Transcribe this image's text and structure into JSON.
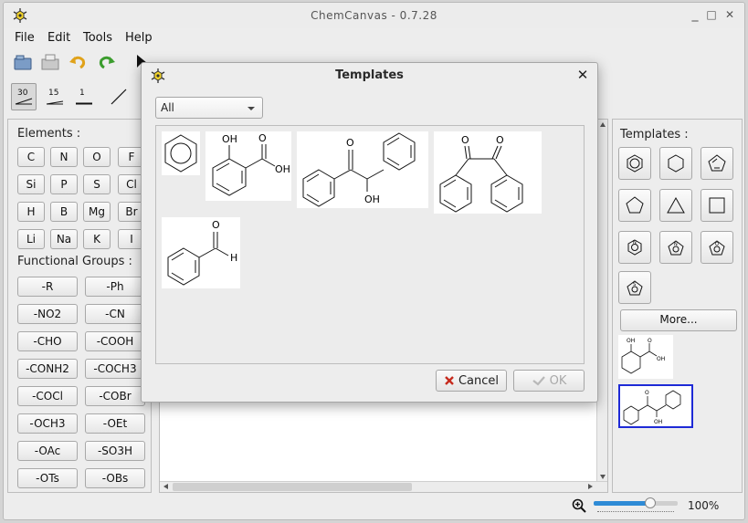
{
  "window": {
    "title": "ChemCanvas - 0.7.28",
    "controls": [
      "_",
      "□",
      "✕"
    ]
  },
  "menu": [
    "File",
    "Edit",
    "Tools",
    "Help"
  ],
  "toolbar2": {
    "bond_30": "30",
    "bond_15": "15",
    "bond_1": "1"
  },
  "left_panel": {
    "elements_label": "Elements :",
    "elements": [
      [
        "C",
        "N",
        "O",
        "F"
      ],
      [
        "Si",
        "P",
        "S",
        "Cl"
      ],
      [
        "H",
        "B",
        "Mg",
        "Br"
      ],
      [
        "Li",
        "Na",
        "K",
        "I"
      ]
    ],
    "functional_groups_label": "Functional Groups :",
    "groups": [
      [
        "-R",
        "-Ph"
      ],
      [
        "-NO2",
        "-CN"
      ],
      [
        "-CHO",
        "-COOH"
      ],
      [
        "-CONH2",
        "-COCH3"
      ],
      [
        "-COCl",
        "-COBr"
      ],
      [
        "-OCH3",
        "-OEt"
      ],
      [
        "-OAc",
        "-SO3H"
      ],
      [
        "-OTs",
        "-OBs"
      ]
    ]
  },
  "right_panel": {
    "templates_label": "Templates :",
    "more_label": "More...",
    "icons": [
      "benzene-icon",
      "cyclohexane-icon",
      "cyclopentadiene-icon",
      "cyclopentane-icon",
      "cyclopropane-icon",
      "cyclobutane-icon",
      "pyridine-icon",
      "pyrrole-icon",
      "furan-icon",
      "thiophene-icon"
    ]
  },
  "status": {
    "zoom": "100%"
  },
  "dialog": {
    "title": "Templates",
    "close": "✕",
    "filter": "All",
    "cancel_label": "Cancel",
    "ok_label": "OK",
    "molecules": [
      {
        "name": "benzene"
      },
      {
        "name": "salicylic acid",
        "labels": [
          "OH",
          "O",
          "OH"
        ]
      },
      {
        "name": "benzoin",
        "labels": [
          "O",
          "OH"
        ]
      },
      {
        "name": "benzil",
        "labels": [
          "O",
          "O"
        ]
      },
      {
        "name": "benzaldehyde",
        "labels": [
          "O",
          "H"
        ]
      }
    ]
  },
  "colors": {
    "selection": "#1e2ad6",
    "accent": "#2e8bd6"
  }
}
